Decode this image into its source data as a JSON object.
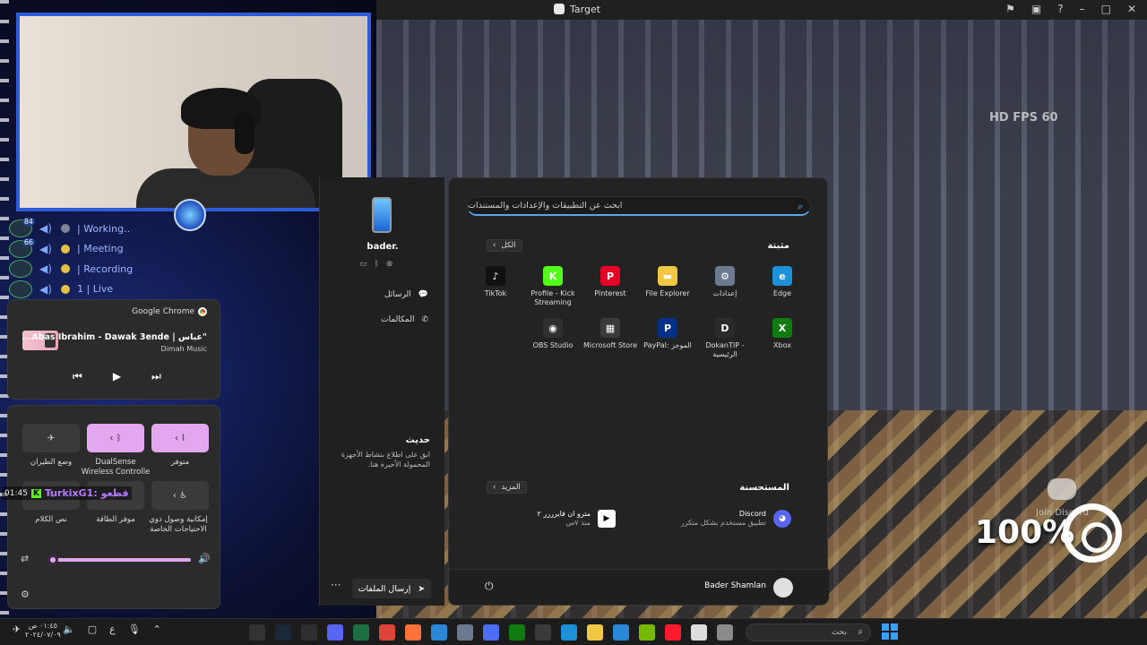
{
  "window": {
    "title": "Target"
  },
  "hud": {
    "text": "HD FPS 60"
  },
  "overlay": {
    "zoom": "100%",
    "discord_join": "Join Discord"
  },
  "voice_channel": {
    "rows": [
      {
        "badge": "84",
        "label": "| Working..",
        "dot": "grey"
      },
      {
        "badge": "66",
        "label": "| Meeting",
        "dot": "yellow"
      },
      {
        "badge": "",
        "label": "| Recording",
        "dot": "yellow"
      },
      {
        "badge": "",
        "label": "1 | Live",
        "dot": "yellow"
      }
    ]
  },
  "media": {
    "source": "Google Chrome",
    "title": "...Abas Ibrahim - Dawak 3ende | عباس\"",
    "artist": "Dimah Music",
    "controls": {
      "prev": "⏮",
      "play": "▶",
      "next": "⏭"
    }
  },
  "quick_settings": {
    "tiles": [
      {
        "label": "متوفر",
        "icons": "‹  ⌇",
        "on": true
      },
      {
        "label": "DualSense Wireless Controlle",
        "icons": "‹  ᛒ",
        "on": true
      },
      {
        "label": "وضع الطيران",
        "icons": "✈",
        "on": false
      },
      {
        "label": "إمكانية وصول ذوي الاحتياجات الخاصة",
        "icons": "‹  ♿",
        "on": false
      },
      {
        "label": "موفر الطاقة",
        "icons": "⚡",
        "on": false
      },
      {
        "label": "نص الكلام",
        "icons": "✎",
        "on": false
      }
    ],
    "volume_percent": 0
  },
  "stream_chip": {
    "time": "01:45",
    "name": "TurkixG1: قطعو"
  },
  "phone": {
    "device": "bader.",
    "items": [
      {
        "label": "الرسائل",
        "icon": "💬"
      },
      {
        "label": "المكالمات",
        "icon": "✆"
      }
    ],
    "recent_title": "حديث",
    "recent_text": "ابق على اطلاع بنشاط الأجهزة المحمولة الأخيرة هنا.",
    "send_files": "إرسال الملفات",
    "more": "···"
  },
  "start_menu": {
    "search_placeholder": "ابحث عن التطبيقات والإعدادات والمستندات",
    "pinned_title": "مثبتة",
    "all_button": "الكل",
    "pinned_apps": [
      {
        "label": "Edge",
        "icon": "edge-icon",
        "color": "#1e90d8",
        "glyph": "e"
      },
      {
        "label": "إعدادات",
        "icon": "gear-icon",
        "color": "#6b7a8f",
        "glyph": "⚙"
      },
      {
        "label": "File Explorer",
        "icon": "folder-icon",
        "color": "#f2c744",
        "glyph": "▬"
      },
      {
        "label": "Pinterest",
        "icon": "pinterest-icon",
        "color": "#e60023",
        "glyph": "P"
      },
      {
        "label": "Profile - Kick Streaming",
        "icon": "kick-icon",
        "color": "#53fc18",
        "glyph": "K"
      },
      {
        "label": "TikTok",
        "icon": "tiktok-icon",
        "color": "#111111",
        "glyph": "♪"
      },
      {
        "label": "Xbox",
        "icon": "xbox-icon",
        "color": "#107c10",
        "glyph": "X"
      },
      {
        "label": "DokanTIP - الرئيسية",
        "icon": "dokantip-icon",
        "color": "#2a2a2a",
        "glyph": "D"
      },
      {
        "label": "PayPal: الموجز",
        "icon": "paypal-icon",
        "color": "#003087",
        "glyph": "P"
      },
      {
        "label": "Microsoft Store",
        "icon": "store-icon",
        "color": "#3a3a3a",
        "glyph": "▦"
      },
      {
        "label": "OBS Studio",
        "icon": "obs-icon",
        "color": "#302e31",
        "glyph": "◉"
      }
    ],
    "recommended_title": "المستحسنة",
    "more_button": "المزيد",
    "recommended": [
      {
        "title": "Discord",
        "subtitle": "تطبيق مستخدم بشكل متكرر",
        "icon": "discord-icon",
        "color": "#5865f2",
        "glyph": "◕"
      },
      {
        "title": "مترو ان فايرررر ٢",
        "subtitle": "منذ ٧س",
        "icon": "video-file-icon",
        "color": "#ffffff",
        "glyph": "▶"
      }
    ],
    "user_name": "Bader Shamlan",
    "power_icon": "⏻"
  },
  "taskbar": {
    "search_placeholder": "بحث",
    "clock_time": "٠١:٤٥ ص",
    "clock_date": "٢٠٢٤/٠٧/٠٩",
    "lang": "ع",
    "apps": [
      {
        "icon": "epic-icon",
        "color": "#333333"
      },
      {
        "icon": "steam-icon",
        "color": "#1b2838"
      },
      {
        "icon": "obs-icon",
        "color": "#302e31"
      },
      {
        "icon": "discord-icon",
        "color": "#5865f2"
      },
      {
        "icon": "excel-icon",
        "color": "#1d6f42"
      },
      {
        "icon": "chrome-icon",
        "color": "#db4437"
      },
      {
        "icon": "firefox-icon",
        "color": "#ff7139"
      },
      {
        "icon": "photos-icon",
        "color": "#2b88d8"
      },
      {
        "icon": "settings-icon",
        "color": "#6b7a8f"
      },
      {
        "icon": "copilot-icon",
        "color": "#4c6ef5"
      },
      {
        "icon": "xbox-icon",
        "color": "#107c10"
      },
      {
        "icon": "store-icon",
        "color": "#3a3a3a"
      },
      {
        "icon": "edge-icon",
        "color": "#1e90d8"
      },
      {
        "icon": "explorer-icon",
        "color": "#f2c744"
      },
      {
        "icon": "phone-link-icon",
        "color": "#2b88d8"
      },
      {
        "icon": "nvidia-icon",
        "color": "#76b900"
      },
      {
        "icon": "opera-icon",
        "color": "#ff1b2d"
      },
      {
        "icon": "snip-icon",
        "color": "#dddddd"
      },
      {
        "icon": "game-icon",
        "color": "#8a8a8a"
      }
    ]
  }
}
